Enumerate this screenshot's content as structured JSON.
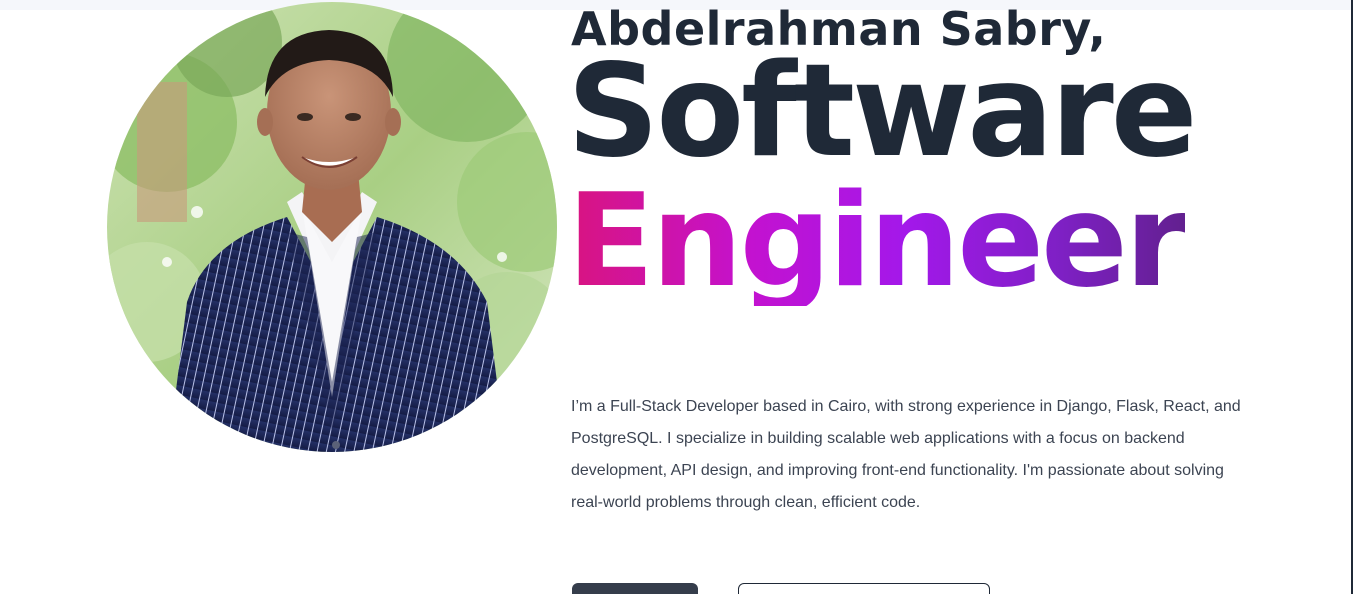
{
  "hero": {
    "name": "Abdelrahman Sabry,",
    "title_line_1": "Software",
    "title_line_2": "Engineer",
    "bio": "I’m a Full-Stack Developer based in Cairo, with strong experience in Django, Flask, React, and PostgreSQL. I specialize in building scalable web applications with a focus on backend development, API design, and improving front-end functionality. I'm passionate about solving real-world problems through clean, efficient code.",
    "primary_button_label": "",
    "secondary_button_label": "",
    "portrait_alt": ""
  },
  "colors": {
    "heading": "#1f2937",
    "gradient_start": "#d9147f",
    "gradient_mid": "#a318ea",
    "gradient_end": "#62208f",
    "body_text": "#3c4452",
    "button_dark": "#353d4b"
  }
}
